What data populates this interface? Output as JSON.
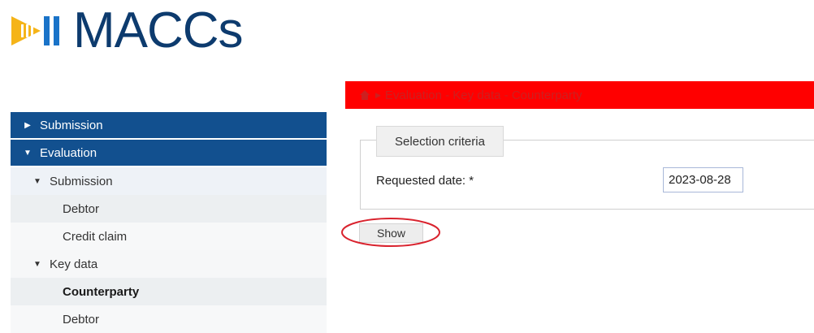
{
  "logo": {
    "text": "MACCs"
  },
  "breadcrumb": {
    "path": "Evaluation - Key data - Counterparty"
  },
  "sidebar": {
    "items": [
      {
        "label": "Submission"
      },
      {
        "label": "Evaluation"
      },
      {
        "label": "Submission"
      },
      {
        "label": "Debtor"
      },
      {
        "label": "Credit claim"
      },
      {
        "label": "Key data"
      },
      {
        "label": "Counterparty"
      },
      {
        "label": "Debtor"
      }
    ]
  },
  "form": {
    "tab_label": "Selection criteria",
    "date_label": "Requested date:  *",
    "date_value": "2023-08-28",
    "show_button": "Show"
  },
  "colors": {
    "nav": "#12508f",
    "banner": "#ff0000",
    "logo": "#0d3b6e",
    "annotation": "#d9232e"
  }
}
